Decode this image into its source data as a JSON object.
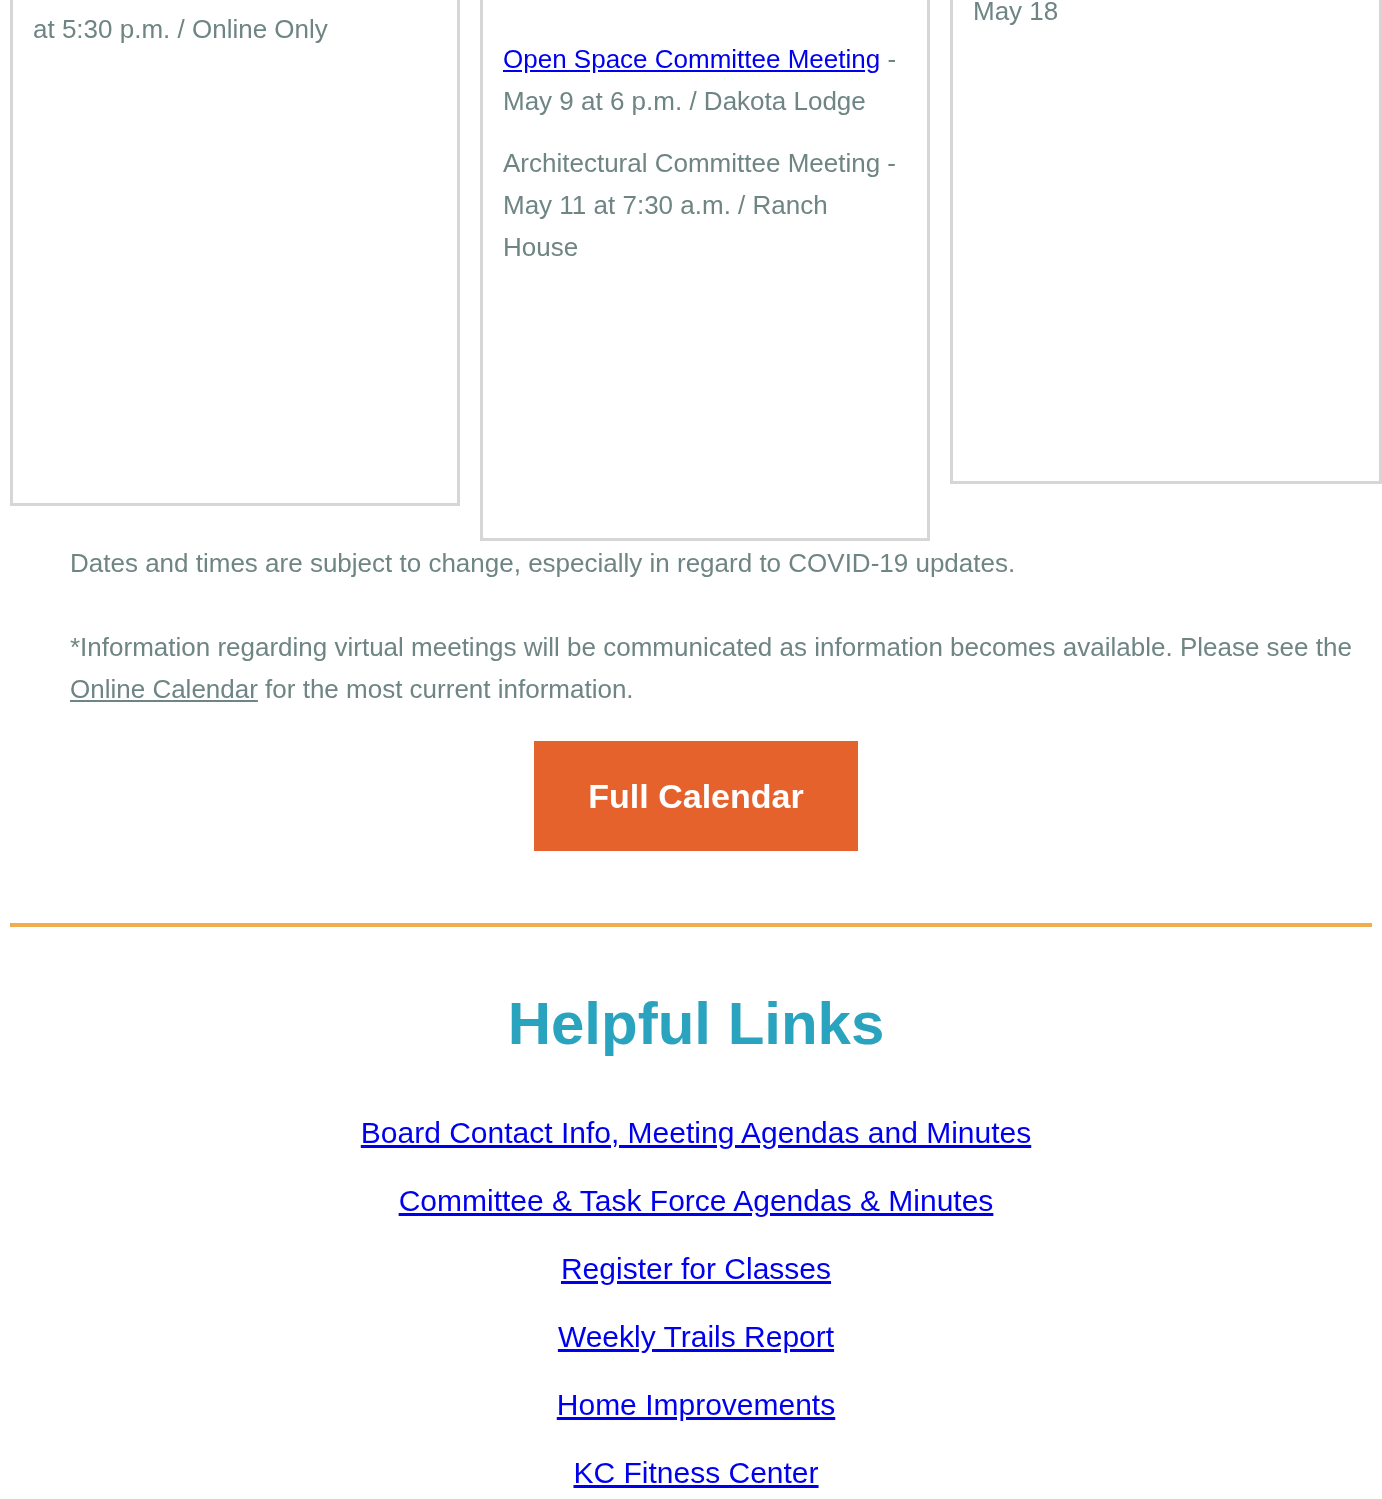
{
  "events": [
    {
      "entries": [
        {
          "text": "at 5:30 p.m. / Online Only"
        }
      ]
    },
    {
      "entries": [
        {
          "link": "Open Space Committee Meeting",
          "text": " - May 9 at 6 p.m. / Dakota Lodge"
        },
        {
          "text": "Architectural Committee Meeting - May 11 at 7:30 a.m. / Ranch House"
        }
      ]
    },
    {
      "entries": [
        {
          "text": "May 18"
        }
      ]
    }
  ],
  "notes": [
    {
      "text": "Dates and times are subject to change, especially in regard to COVID-19 updates."
    },
    {
      "text": "*Information regarding virtual meetings will be communicated as information becomes available. Please see the ",
      "link": "Online Calendar",
      "after": " for the most current information."
    }
  ],
  "button": "Full Calendar",
  "links_heading": "Helpful Links",
  "links": [
    "Board Contact Info, Meeting Agendas and Minutes",
    "Committee & Task Force Agendas & Minutes",
    "Register for Classes",
    "Weekly Trails Report",
    "Home Improvements",
    "KC Fitness Center"
  ]
}
